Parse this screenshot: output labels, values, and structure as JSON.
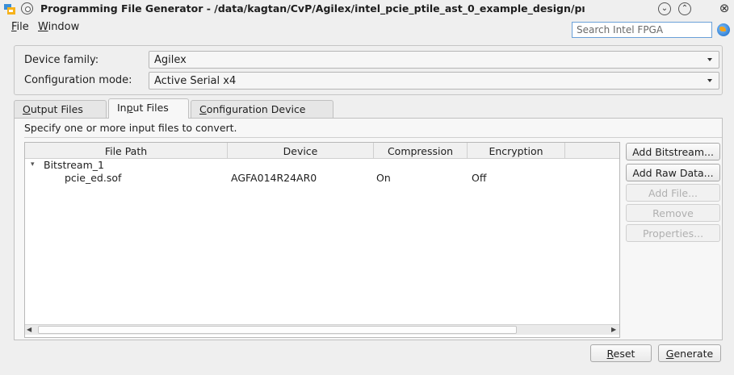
{
  "window": {
    "title": "Programming File Generator - /data/kagtan/CvP/Agilex/intel_pcie_ptile_ast_0_example_design/pı",
    "minimize_glyph": "⌄",
    "maximize_glyph": "⌃",
    "close_glyph": "⊗"
  },
  "menubar": {
    "file_key": "F",
    "file_rest": "ile",
    "window_key": "W",
    "window_rest": "indow"
  },
  "search": {
    "placeholder": "Search Intel FPGA"
  },
  "device": {
    "family_label": "Device family:",
    "family_value": "Agilex",
    "config_label": "Configuration mode:",
    "config_value": "Active Serial x4"
  },
  "tabs": {
    "output_key": "O",
    "output_rest": "utput Files",
    "input_pre": "In",
    "input_key": "p",
    "input_rest": "ut Files",
    "config_key": "C",
    "config_rest": "onfiguration Device",
    "active": "Input Files"
  },
  "input_tab": {
    "instruction": "Specify one or more input files to convert."
  },
  "table": {
    "columns": [
      "File Path",
      "Device",
      "Compression",
      "Encryption"
    ],
    "group": "Bitstream_1",
    "rows": [
      {
        "file": "pcie_ed.sof",
        "device": "AGFA014R24AR0",
        "compression": "On",
        "encryption": "Off"
      }
    ]
  },
  "side_buttons": {
    "add_bitstream": "Add Bitstream...",
    "add_raw_data": "Add Raw Data...",
    "add_file": "Add File...",
    "remove": "Remove",
    "properties": "Properties..."
  },
  "footer": {
    "reset_key": "R",
    "reset_rest": "eset",
    "generate_key": "G",
    "generate_rest": "enerate"
  },
  "icons": {
    "app": "programming-file-generator-icon",
    "system_menu": "system-menu-icon",
    "globe": "globe-icon",
    "tree_expand": "chevron-down-icon",
    "combo_arrow": "dropdown-arrow-icon"
  }
}
